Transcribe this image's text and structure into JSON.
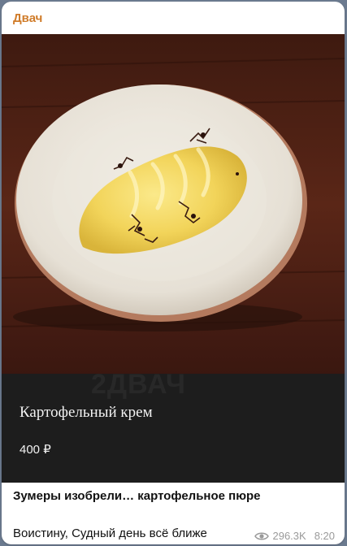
{
  "channel": {
    "name": "Двач",
    "name_color": "#d07c2a"
  },
  "media": {
    "watermark": "2ДВАЧ",
    "dish_title": "Картофельный крем",
    "price": "400 ₽"
  },
  "post": {
    "title": "Зумеры изобрели… картофельное пюре",
    "body": "Воистину, Судный день всё ближе",
    "views": "296.3K",
    "time": "8:20"
  },
  "icons": {
    "views": "eye-icon"
  }
}
